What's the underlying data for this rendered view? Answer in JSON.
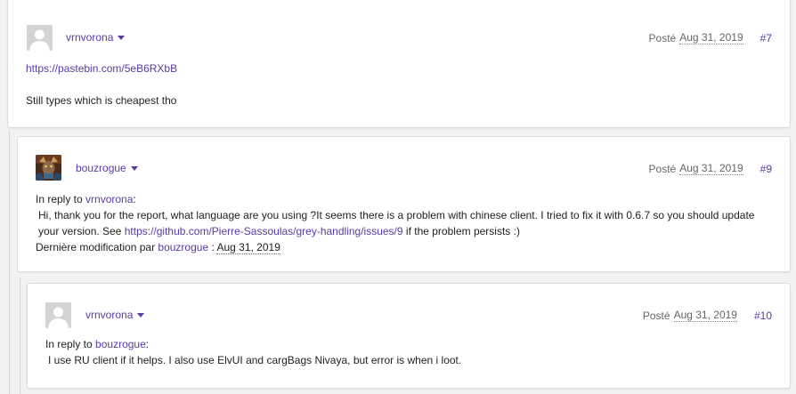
{
  "colors": {
    "accent": "#5b3aa3",
    "card_bg": "#ffffff",
    "page_bg": "#f2f2f2"
  },
  "posts": [
    {
      "author": "vrnvorona",
      "avatar_icon": "default-avatar-icon",
      "posted_label": "Posté",
      "date": "Aug 31, 2019",
      "number": "#7",
      "link": "https://pastebin.com/5eB6RXbB",
      "text": "Still types which is cheapest tho"
    },
    {
      "author": "bouzrogue",
      "avatar_icon": "character-portrait-avatar",
      "posted_label": "Posté",
      "date": "Aug 31, 2019",
      "number": "#9",
      "reply_prefix": "In reply to",
      "reply_to": "vrnvorona",
      "reply_suffix": ":",
      "text_before_link": "Hi, thank you for the report, what language are you using ?It seems there is a problem with chinese client. I tried to fix it with 0.6.7 so you should update your version. See",
      "link": "https://github.com/Pierre-Sassoulas/grey-handling/issues/9",
      "text_after_link": "if the problem persists :)",
      "edited_prefix": "Dernière modification par",
      "edited_by": "bouzrogue",
      "edited_sep": ":",
      "edited_date": "Aug 31, 2019"
    },
    {
      "author": "vrnvorona",
      "avatar_icon": "default-avatar-icon",
      "posted_label": "Posté",
      "date": "Aug 31, 2019",
      "number": "#10",
      "reply_prefix": "In reply to",
      "reply_to": "bouzrogue",
      "reply_suffix": ":",
      "text": "I use RU client if it helps. I also use ElvUI and cargBags Nivaya, but error is when i loot."
    }
  ]
}
